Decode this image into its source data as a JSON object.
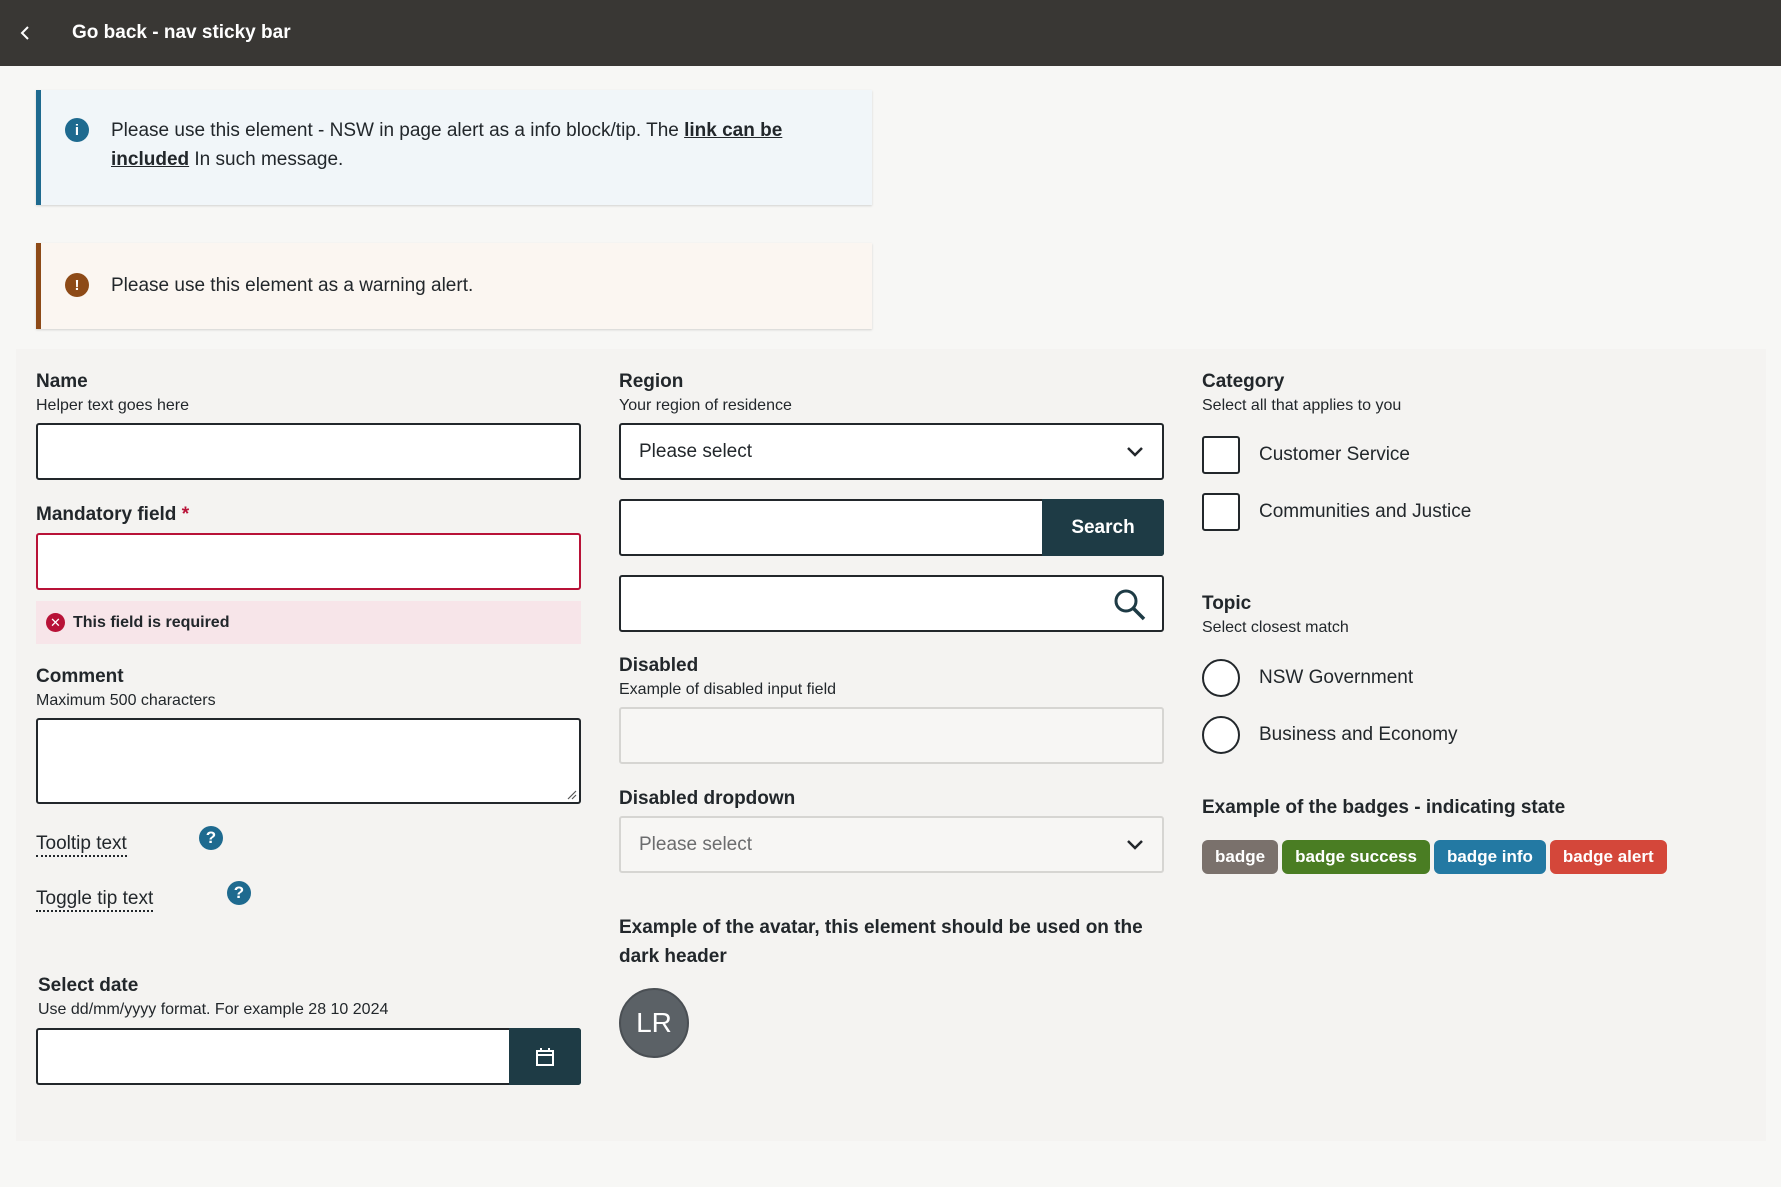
{
  "topbar": {
    "title": "Go back - nav sticky bar"
  },
  "alerts": {
    "info": {
      "text_before": "Please use this element - NSW in page alert as a info block/tip. The ",
      "link": "link can be included",
      "text_after": " In such message."
    },
    "warning": {
      "text": "Please use this element as a warning alert."
    }
  },
  "form": {
    "name": {
      "label": "Name",
      "helper": "Helper text goes here",
      "value": ""
    },
    "mandatory": {
      "label": "Mandatory field",
      "star": "*",
      "error": "This field is required",
      "value": ""
    },
    "comment": {
      "label": "Comment",
      "helper": "Maximum 500 characters",
      "value": ""
    },
    "tooltip": {
      "label": "Tooltip text",
      "icon": "?"
    },
    "toggletip": {
      "label": "Toggle tip text",
      "icon": "?"
    },
    "date": {
      "label": "Select date",
      "helper": "Use dd/mm/yyyy format. For example 28 10 2024",
      "value": ""
    },
    "region": {
      "label": "Region",
      "helper": "Your region of residence",
      "selected": "Please select"
    },
    "search": {
      "button": "Search",
      "value": ""
    },
    "disabled": {
      "label": "Disabled",
      "helper": "Example of disabled input field"
    },
    "disabled_dropdown": {
      "label": "Disabled dropdown",
      "selected": "Please select"
    },
    "avatar": {
      "heading": "Example of the avatar, this element should be used on the dark header",
      "initials": "LR"
    },
    "category": {
      "label": "Category",
      "helper": "Select all that applies to you",
      "options": [
        "Customer Service",
        "Communities and Justice"
      ]
    },
    "topic": {
      "label": "Topic",
      "helper": "Select closest match",
      "options": [
        "NSW Government",
        "Business and Economy"
      ]
    },
    "badges": {
      "heading": "Example of the badges - indicating state",
      "items": [
        {
          "label": "badge",
          "color": "#7a716c"
        },
        {
          "label": "badge success",
          "color": "#4a7d23"
        },
        {
          "label": "badge info",
          "color": "#2379a3"
        },
        {
          "label": "badge alert",
          "color": "#d4473a"
        }
      ]
    }
  }
}
